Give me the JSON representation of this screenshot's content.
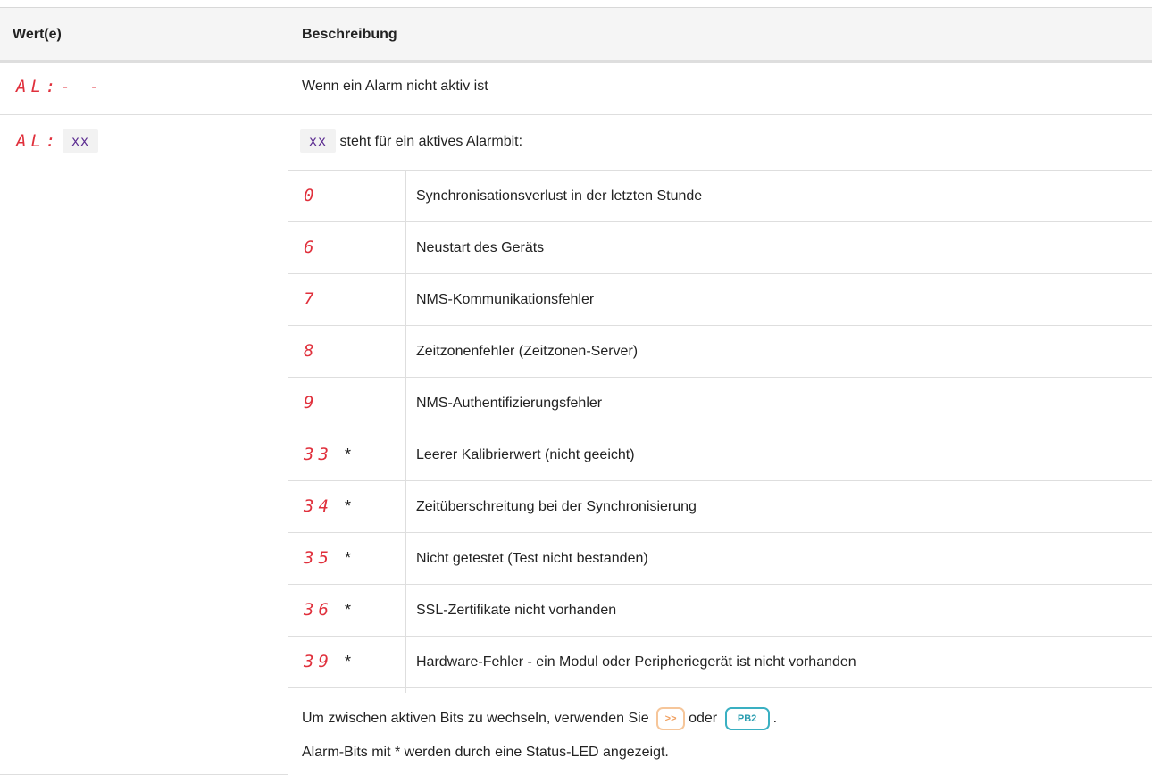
{
  "header": {
    "col_value": "Wert(e)",
    "col_description": "Beschreibung"
  },
  "rows": [
    {
      "display": "AL:- -",
      "description": "Wenn ein Alarm nicht aktiv ist"
    },
    {
      "display_prefix": "AL:",
      "display_code": "xx",
      "description_code": "xx",
      "description": "steht für ein aktives Alarmbit:"
    }
  ],
  "alarms": [
    {
      "code": "0",
      "star": "",
      "text": "Synchronisationsverlust in der letzten Stunde"
    },
    {
      "code": "6",
      "star": "",
      "text": "Neustart des Geräts"
    },
    {
      "code": "7",
      "star": "",
      "text": "NMS-Kommunikationsfehler"
    },
    {
      "code": "8",
      "star": "",
      "text": "Zeitzonenfehler (Zeitzonen-Server)"
    },
    {
      "code": "9",
      "star": "",
      "text": "NMS-Authentifizierungsfehler"
    },
    {
      "code": "33",
      "star": "*",
      "text": "Leerer Kalibrierwert (nicht geeicht)"
    },
    {
      "code": "34",
      "star": "*",
      "text": "Zeitüberschreitung bei der Synchronisierung"
    },
    {
      "code": "35",
      "star": "*",
      "text": "Nicht getestet (Test nicht bestanden)"
    },
    {
      "code": "36",
      "star": "*",
      "text": "SSL-Zertifikate nicht vorhanden"
    },
    {
      "code": "39",
      "star": "*",
      "text": "Hardware-Fehler - ein Modul oder Peripheriegerät ist nicht vorhanden"
    }
  ],
  "footer": {
    "switch_text_before": "Um zwischen aktiven Bits zu wechseln, verwenden Sie",
    "key_next": ">>",
    "or_text": "oder",
    "key_pb2": "PB2",
    "period": ".",
    "note": "Alarm-Bits mit * werden durch eine Status-LED angezeigt."
  },
  "colors": {
    "segment_red": "#e0303c",
    "code_purple": "#5c2d91",
    "key_orange": "#f0a060",
    "key_teal": "#2a9db0"
  }
}
